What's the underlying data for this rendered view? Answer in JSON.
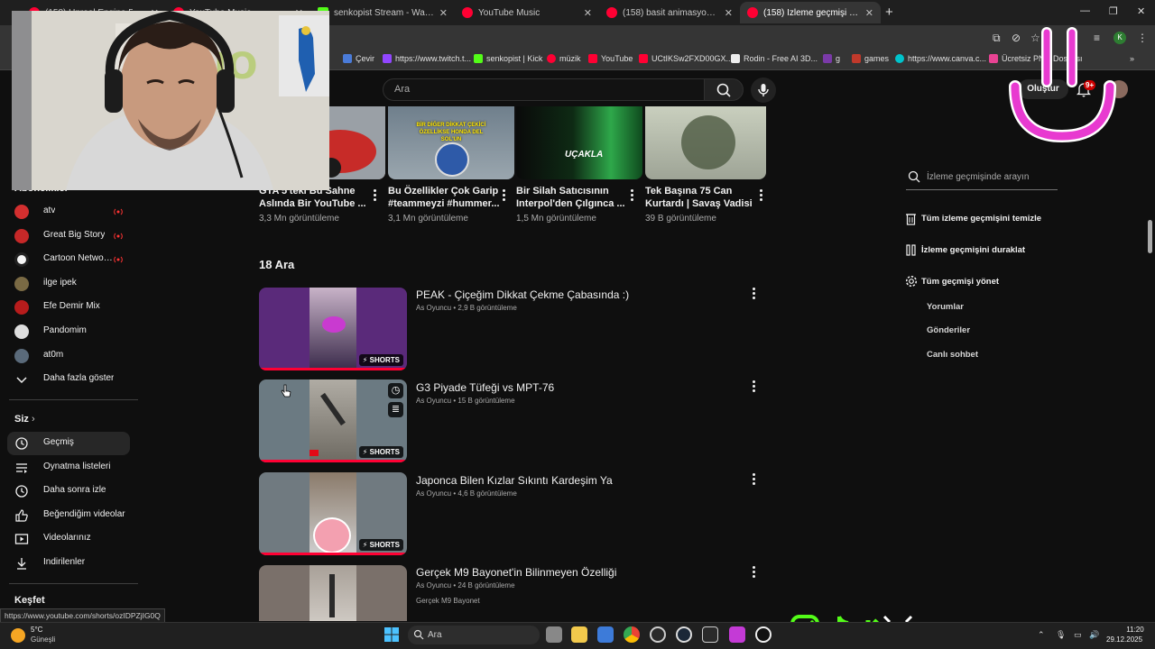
{
  "browser": {
    "tabs": [
      {
        "title": "(158) Unreal Engine 5 Tutorial",
        "favicon_color": "#ff0033"
      },
      {
        "title": "YouTube Music",
        "favicon_color": "#ff0033"
      },
      {
        "title": "senkopist Stream - Watch Live on Kick",
        "favicon_color": "#53fc18"
      },
      {
        "title": "YouTube Music",
        "favicon_color": "#ff0033"
      },
      {
        "title": "(158) basit animasyon film yapımı",
        "favicon_color": "#ff0033"
      },
      {
        "title": "(158) İzleme geçmişi - YouTube",
        "favicon_color": "#ff0033"
      }
    ],
    "bookmarks": [
      {
        "label": "Çevir",
        "color": "#4a7bd8"
      },
      {
        "label": "https://www.twitch.t...",
        "color": "#9146ff"
      },
      {
        "label": "senkopist | Kick",
        "color": "#53fc18"
      },
      {
        "label": "müzik",
        "color": "#ff0033"
      },
      {
        "label": "YouTube",
        "color": "#ff0033"
      },
      {
        "label": "UCtIKSw2FXD00GX...",
        "color": "#ff0033"
      },
      {
        "label": "Rodin - Free AI 3D...",
        "color": "#eeeeee"
      },
      {
        "label": "g",
        "color": "#7a3aa8"
      },
      {
        "label": "games",
        "color": "#c0392b"
      },
      {
        "label": "https://www.canva.c...",
        "color": "#00c4cc"
      },
      {
        "label": "Ücretsiz PNG Dosyası",
        "color": "#e84393"
      }
    ],
    "profile_letter": "K",
    "status_url": "https://www.youtube.com/shorts/ozIDPZjIG0Q"
  },
  "header": {
    "search_placeholder": "Ara",
    "create_label": "Oluştur",
    "notifications": "9+"
  },
  "sidebar": {
    "subscriptions_heading": "Abonelikler",
    "subscriptions": [
      {
        "label": "atv",
        "live": true,
        "color": "#d32f2f"
      },
      {
        "label": "Great Big Story",
        "live": true,
        "color": "#c62828"
      },
      {
        "label": "Cartoon Network...",
        "live": true,
        "color": "#222222"
      },
      {
        "label": "ilge ipek",
        "live": false,
        "color": "#7a6a44"
      },
      {
        "label": "Efe Demir Mix",
        "live": false,
        "color": "#b71c1c"
      },
      {
        "label": "Pandomim",
        "live": false,
        "color": "#dddddd"
      },
      {
        "label": "at0m",
        "live": false,
        "color": "#5a6a7a"
      }
    ],
    "show_more": "Daha fazla göster",
    "you_heading": "Siz",
    "you_items": [
      {
        "label": "Geçmiş",
        "icon": "history-icon",
        "active": true
      },
      {
        "label": "Oynatma listeleri",
        "icon": "playlists-icon",
        "active": false
      },
      {
        "label": "Daha sonra izle",
        "icon": "watch-later-icon",
        "active": false
      },
      {
        "label": "Beğendiğim videolar",
        "icon": "like-icon",
        "active": false
      },
      {
        "label": "Videolarınız",
        "icon": "your-videos-icon",
        "active": false
      },
      {
        "label": "İndirilenler",
        "icon": "download-icon",
        "active": false
      }
    ],
    "explore_heading": "Keşfet"
  },
  "top_videos": [
    {
      "title": "GTA 5'teki Bu Sahne Aslında Bir YouTube ...",
      "views": "3,3 Mn görüntüleme",
      "thumb": "#b3362d",
      "thumb_text": ""
    },
    {
      "title": "Bu Özellikler Çok Garip #teammeyzi #hummer...",
      "views": "3,1 Mn görüntüleme",
      "thumb": "#6f7f8c",
      "thumb_text": "BİR DİĞER DİKKAT ÇEKİCİ ÖZELLİKSE HONDA DEL SOL'UN"
    },
    {
      "title": "Bir Silah Satıcısının Interpol'den Çılgınca ...",
      "views": "1,5 Mn görüntüleme",
      "thumb": "#1b6b2c",
      "thumb_text": "UÇAKLA"
    },
    {
      "title": "Tek Başına 75 Can Kurtardı | Savaş Vadisi",
      "views": "39 B görüntüleme",
      "thumb": "#b9bfae",
      "thumb_text": ""
    }
  ],
  "section_day": "18 Ara",
  "shorts": [
    {
      "title": "PEAK - Çiçeğim Dikkat Çekme Çabasında :)",
      "channel": "As Oyuncu",
      "views": "2,9 B görüntüleme",
      "badge": "SHORTS",
      "bg": "#5a2a7a",
      "inner": "#3a2a4a",
      "progress": 1.0,
      "sub": ""
    },
    {
      "title": "G3 Piyade Tüfeği vs MPT-76",
      "channel": "As Oyuncu",
      "views": "15 B görüntüleme",
      "badge": "SHORTS",
      "bg": "#6b7a82",
      "inner": "#8a8a84",
      "progress": 1.0,
      "sub": ""
    },
    {
      "title": "Japonca Bilen Kızlar Sıkıntı Kardeşim Ya",
      "channel": "As Oyuncu",
      "views": "4,6 B görüntüleme",
      "badge": "SHORTS",
      "bg": "#707a80",
      "inner": "#5a6066",
      "progress": 1.0,
      "sub": ""
    },
    {
      "title": "Gerçek M9 Bayonet'in Bilinmeyen Özelliği",
      "channel": "As Oyuncu",
      "views": "24 B görüntüleme",
      "badge": "",
      "bg": "#7a706a",
      "inner": "#a09890",
      "progress": 0,
      "sub": "Gerçek M9 Bayonet"
    }
  ],
  "history_panel": {
    "search_placeholder": "İzleme geçmişinde arayın",
    "clear_all": "Tüm izleme geçmişini temizle",
    "pause": "İzleme geçmişini duraklat",
    "manage_all": "Tüm geçmişi yönet",
    "comments": "Yorumlar",
    "posts": "Gönderiler",
    "live_chat": "Canlı sohbet"
  },
  "taskbar": {
    "temperature": "5°C",
    "weather": "Güneşli",
    "search_label": "Ara",
    "time": "11:20",
    "date": "29.12.2025"
  }
}
